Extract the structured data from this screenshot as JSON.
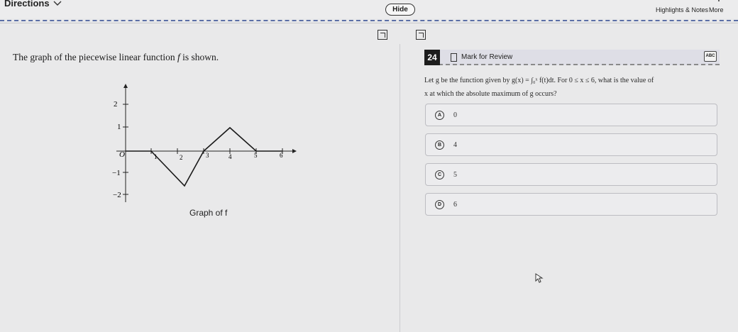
{
  "topbar": {
    "directions_label": "Directions",
    "hide_label": "Hide",
    "highlights_label": "Highlights & Notes",
    "more_label": "More"
  },
  "left": {
    "prompt_pre": "The graph of the piecewise linear function ",
    "prompt_var": "f",
    "prompt_post": " is shown.",
    "caption": "Graph of f",
    "graph": {
      "x_ticks": [
        "1",
        "2",
        "3",
        "4",
        "5",
        "6"
      ],
      "y_ticks": [
        "2",
        "1",
        "−1",
        "−2"
      ],
      "origin_label": "O",
      "points": [
        [
          0,
          0
        ],
        [
          1,
          0
        ],
        [
          2,
          -1.5
        ],
        [
          3,
          0
        ],
        [
          4,
          1
        ],
        [
          5,
          0
        ],
        [
          6,
          0
        ]
      ]
    }
  },
  "question": {
    "number": "24",
    "mark_label": "Mark for Review",
    "abc_label": "ABC",
    "line1": "Let g be the function given by g(x) = ∫₀ˣ f(t)dt. For 0 ≤ x ≤ 6, what is the value of",
    "line2": "x at which the absolute maximum of g occurs?",
    "choices": [
      {
        "letter": "A",
        "value": "0"
      },
      {
        "letter": "B",
        "value": "4"
      },
      {
        "letter": "C",
        "value": "5"
      },
      {
        "letter": "D",
        "value": "6"
      }
    ]
  }
}
